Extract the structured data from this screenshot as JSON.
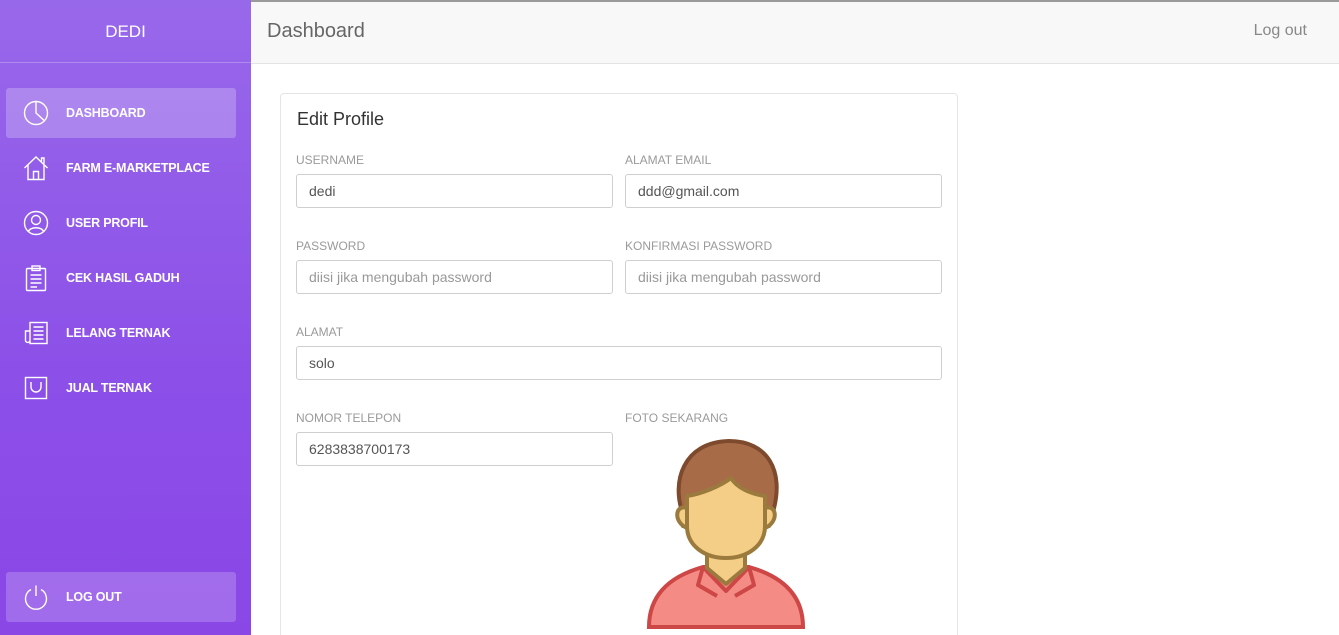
{
  "sidebar": {
    "brand": "DEDI",
    "items": [
      {
        "label": "DASHBOARD",
        "icon": "pie-chart-icon"
      },
      {
        "label": "FARM E-MARKETPLACE",
        "icon": "home-icon"
      },
      {
        "label": "USER PROFIL",
        "icon": "user-icon"
      },
      {
        "label": "CEK HASIL GADUH",
        "icon": "clipboard-icon"
      },
      {
        "label": "LELANG TERNAK",
        "icon": "newspaper-icon"
      },
      {
        "label": "JUAL TERNAK",
        "icon": "bag-icon"
      }
    ],
    "logout": {
      "label": "LOG OUT",
      "icon": "power-icon"
    }
  },
  "topbar": {
    "title": "Dashboard",
    "logout_label": "Log out"
  },
  "profile": {
    "title": "Edit Profile",
    "username": {
      "label": "USERNAME",
      "value": "dedi"
    },
    "email": {
      "label": "ALAMAT EMAIL",
      "value": "ddd@gmail.com"
    },
    "password": {
      "label": "PASSWORD",
      "placeholder": "diisi jika mengubah password"
    },
    "confirm_password": {
      "label": "KONFIRMASI PASSWORD",
      "placeholder": "diisi jika mengubah password"
    },
    "address": {
      "label": "ALAMAT",
      "value": "solo"
    },
    "phone": {
      "label": "NOMOR TELEPON",
      "value": "6283838700173"
    },
    "photo": {
      "label": "FOTO SEKARANG"
    }
  },
  "colors": {
    "sidebar_top": "#9868ea",
    "sidebar_bottom": "#8a47e6",
    "topbar_bg": "#f8f8f8"
  }
}
